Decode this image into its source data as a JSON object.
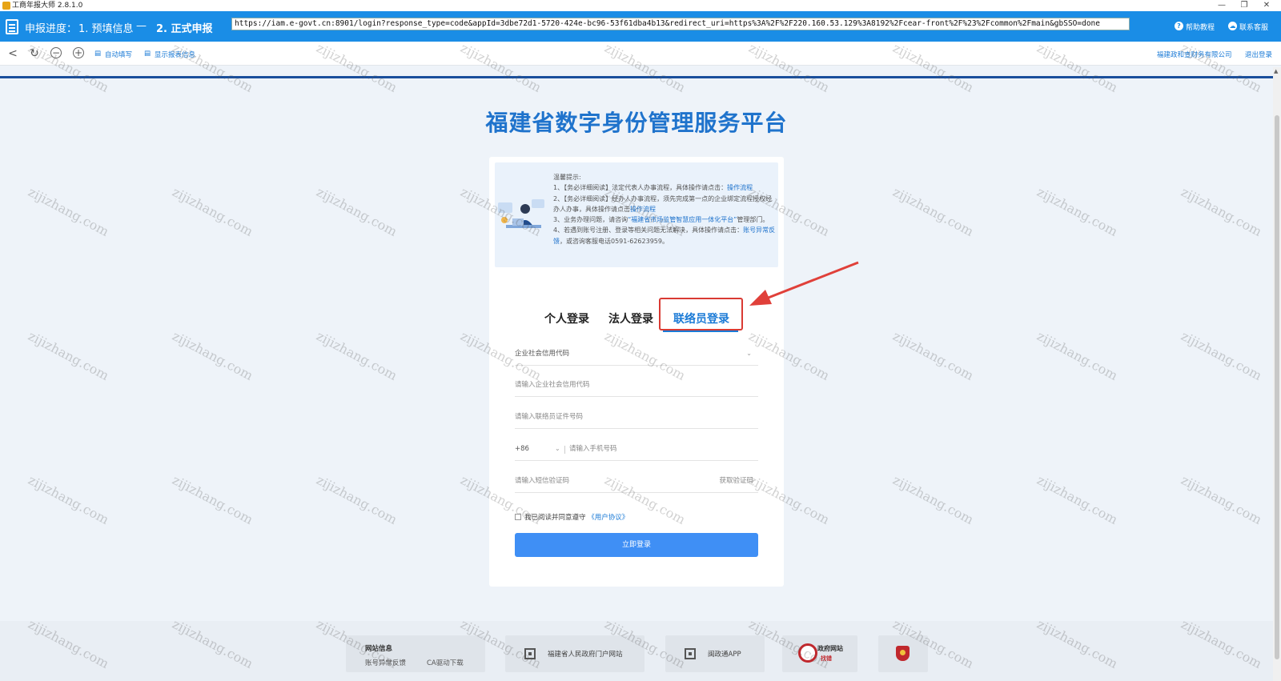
{
  "window": {
    "title": "工商年报大师 2.8.1.0",
    "controls": [
      "—",
      "❐",
      "✕"
    ]
  },
  "header": {
    "progress_label": "申报进度：",
    "step1": "1. 预填信息",
    "separator": "—",
    "step2": "2. 正式申报",
    "url": "https://iam.e-govt.cn:8901/login?response_type=code&appId=3dbe72d1-5720-424e-bc96-53f61dba4b13&redirect_uri=https%3A%2F%2F220.160.53.129%3A8192%2Fcear-front%2F%23%2Fcommon%2Fmain&gbSSO=done",
    "help": "帮助教程",
    "contact": "联系客服"
  },
  "toolbar": {
    "back": "<",
    "refresh": "↻",
    "zoom_out": "−",
    "zoom_in": "+",
    "autofill": "自动填写",
    "show_data": "显示报表信息",
    "company": "福建政和查财务有限公司",
    "logout": "退出登录"
  },
  "page": {
    "title": "福建省数字身份管理服务平台"
  },
  "notice": {
    "heading": "温馨提示:",
    "line1": "1、【务必详细阅读】法定代表人办事流程，具体操作请点击：",
    "line1_link": "操作流程",
    "line2": "2、【务必详细阅读】经办人办事流程，须先完成第一点的企业绑定流程授权经办人办事，具体操作请点击",
    "line2_link": "操作流程",
    "line3": "3、业务办理问题，请咨询",
    "line3_link": "“福建省市场监管智慧应用一体化平台”",
    "line3_tail": "管理部门。",
    "line4": "4、若遇到账号注册、登录等相关问题无法解决，具体操作请点击：",
    "line4_link": "账号异常反馈",
    "line4_tail": "，或咨询客服电话0591-62623959。"
  },
  "tabs": {
    "personal": "个人登录",
    "legal": "法人登录",
    "liaison": "联络员登录"
  },
  "form": {
    "credit_type": "企业社会信用代码",
    "credit_placeholder": "请输入企业社会信用代码",
    "id_placeholder": "请输入联络员证件号码",
    "country_code": "+86",
    "phone_placeholder": "请输入手机号码",
    "sms_placeholder": "请输入短信验证码",
    "get_code": "获取验证码",
    "agree_text": "我已阅读并同意遵守",
    "agree_link": "《用户协议》",
    "submit": "立即登录"
  },
  "footer": {
    "site_info": "网站信息",
    "account_feedback": "账号异常反馈",
    "ca_download": "CA驱动下载",
    "portal": "福建省人民政府门户网站",
    "app": "闽政通APP",
    "gov_site": "政府网站",
    "gov_site_sub": "找错"
  },
  "watermark": "zijizhang.com",
  "colors": {
    "header": "#1a8de6",
    "accent": "#1a7ad6",
    "button": "#3f8ff5",
    "highlight": "#d93a33"
  }
}
